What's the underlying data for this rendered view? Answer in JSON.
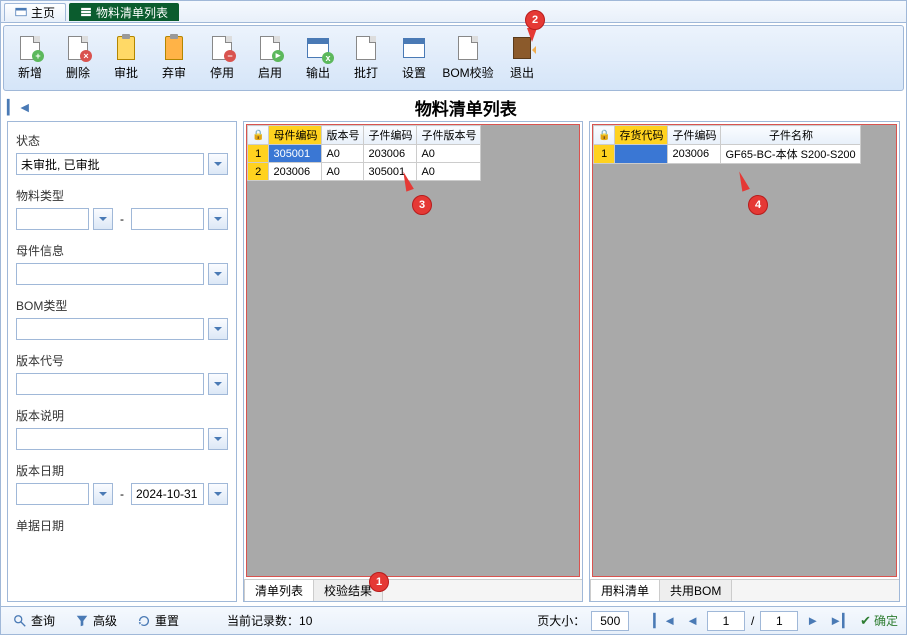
{
  "tabs": {
    "home": "主页",
    "main": "物料清单列表"
  },
  "toolbar": {
    "new": "新增",
    "delete": "删除",
    "approve": "审批",
    "reject": "弃审",
    "stop": "停用",
    "enable": "启用",
    "export": "输出",
    "batch_print": "批打",
    "settings": "设置",
    "bom_check": "BOM校验",
    "exit": "退出"
  },
  "title": "物料清单列表",
  "filters": {
    "status": {
      "label": "状态",
      "value": "未审批, 已审批"
    },
    "material_type": {
      "label": "物料类型"
    },
    "parent_info": {
      "label": "母件信息"
    },
    "bom_type": {
      "label": "BOM类型"
    },
    "version_code": {
      "label": "版本代号"
    },
    "version_desc": {
      "label": "版本说明"
    },
    "version_date": {
      "label": "版本日期",
      "to": "2024-10-31"
    },
    "doc_date": {
      "label": "单据日期"
    }
  },
  "grid_left": {
    "headers": [
      "母件编码",
      "版本号",
      "子件编码",
      "子件版本号"
    ],
    "rows": [
      {
        "n": "1",
        "parent": "305001",
        "ver": "A0",
        "child": "203006",
        "cver": "A0"
      },
      {
        "n": "2",
        "parent": "203006",
        "ver": "A0",
        "child": "305001",
        "cver": "A0"
      }
    ],
    "tabs": [
      "清单列表",
      "校验结果"
    ]
  },
  "grid_right": {
    "headers": [
      "存货代码",
      "子件编码",
      "子件名称"
    ],
    "rows": [
      {
        "n": "1",
        "code": "",
        "child": "203006",
        "name": "GF65-BC-本体  S200-S200"
      }
    ],
    "tabs": [
      "用料清单",
      "共用BOM"
    ]
  },
  "status_bar": {
    "query": "查询",
    "advanced": "高级",
    "reset": "重置",
    "record_count": "当前记录数：10",
    "page_size_label": "页大小：",
    "page_size": "500",
    "page": "1",
    "page_sep": "/",
    "total_pages": "1",
    "confirm": "确定"
  },
  "callouts": {
    "c1": "1",
    "c2": "2",
    "c3": "3",
    "c4": "4"
  }
}
